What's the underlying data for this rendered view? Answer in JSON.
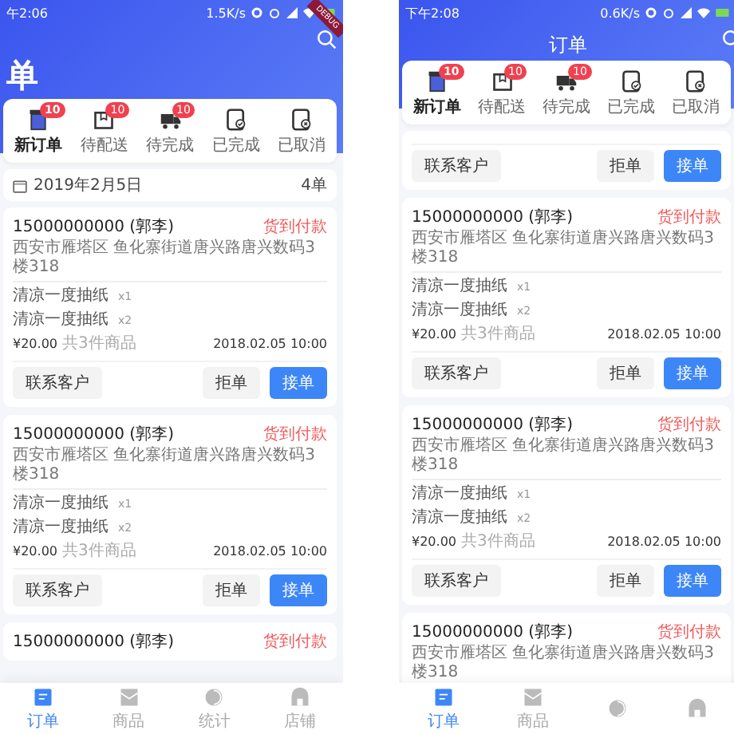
{
  "phones": [
    {
      "status_bar": {
        "time": "午2:06",
        "speed": "1.5K/s"
      },
      "debug_banner": "DEBUG",
      "title": "单",
      "title_large": true,
      "tabs": [
        {
          "label": "新订单",
          "badge": "10",
          "selected": true
        },
        {
          "label": "待配送",
          "badge": "10",
          "selected": false
        },
        {
          "label": "待完成",
          "badge": "10",
          "selected": false
        },
        {
          "label": "已完成",
          "selected": false
        },
        {
          "label": "已取消",
          "selected": false
        }
      ],
      "date_row": {
        "date": "2019年2月5日",
        "count": "4单"
      },
      "orders": [
        {
          "kind": "full",
          "phone": "15000000000 (郭李)",
          "payment": "货到付款",
          "address": "西安市雁塔区 鱼化寨街道唐兴路唐兴数码3楼318",
          "items": [
            {
              "name": "清凉一度抽纸",
              "qty": "x1"
            },
            {
              "name": "清凉一度抽纸",
              "qty": "x2"
            }
          ],
          "price": "¥20.00",
          "summary": "共3件商品",
          "time": "2018.02.05 10:00",
          "buttons": [
            {
              "label": "联系客户",
              "kind": "plain"
            },
            {
              "label": "拒单",
              "kind": "plain"
            },
            {
              "label": "接单",
              "kind": "primary"
            }
          ]
        },
        {
          "kind": "full",
          "phone": "15000000000 (郭李)",
          "payment": "货到付款",
          "address": "西安市雁塔区 鱼化寨街道唐兴路唐兴数码3楼318",
          "items": [
            {
              "name": "清凉一度抽纸",
              "qty": "x1"
            },
            {
              "name": "清凉一度抽纸",
              "qty": "x2"
            }
          ],
          "price": "¥20.00",
          "summary": "共3件商品",
          "time": "2018.02.05 10:00",
          "buttons": [
            {
              "label": "联系客户",
              "kind": "plain"
            },
            {
              "label": "拒单",
              "kind": "plain"
            },
            {
              "label": "接单",
              "kind": "primary"
            }
          ]
        },
        {
          "kind": "header",
          "phone": "15000000000 (郭李)",
          "payment": "货到付款"
        }
      ],
      "nav": [
        {
          "label": "订单",
          "selected": true
        },
        {
          "label": "商品",
          "selected": false
        },
        {
          "label": "统计",
          "selected": false
        },
        {
          "label": "店铺",
          "selected": false
        }
      ]
    },
    {
      "status_bar": {
        "time": "下午2:08",
        "speed": "0.6K/s"
      },
      "title": "订单",
      "title_large": false,
      "tabs": [
        {
          "label": "新订单",
          "badge": "10",
          "selected": true
        },
        {
          "label": "待配送",
          "badge": "10",
          "selected": false
        },
        {
          "label": "待完成",
          "badge": "10",
          "selected": false
        },
        {
          "label": "已完成",
          "selected": false
        },
        {
          "label": "已取消",
          "selected": false
        }
      ],
      "orders": [
        {
          "kind": "actions",
          "buttons": [
            {
              "label": "联系客户",
              "kind": "plain"
            },
            {
              "label": "拒单",
              "kind": "plain"
            },
            {
              "label": "接单",
              "kind": "primary"
            }
          ]
        },
        {
          "kind": "full",
          "phone": "15000000000 (郭李)",
          "payment": "货到付款",
          "address": "西安市雁塔区 鱼化寨街道唐兴路唐兴数码3楼318",
          "items": [
            {
              "name": "清凉一度抽纸",
              "qty": "x1"
            },
            {
              "name": "清凉一度抽纸",
              "qty": "x2"
            }
          ],
          "price": "¥20.00",
          "summary": "共3件商品",
          "time": "2018.02.05 10:00",
          "buttons": [
            {
              "label": "联系客户",
              "kind": "plain"
            },
            {
              "label": "拒单",
              "kind": "plain"
            },
            {
              "label": "接单",
              "kind": "primary"
            }
          ]
        },
        {
          "kind": "full",
          "phone": "15000000000 (郭李)",
          "payment": "货到付款",
          "address": "西安市雁塔区 鱼化寨街道唐兴路唐兴数码3楼318",
          "items": [
            {
              "name": "清凉一度抽纸",
              "qty": "x1"
            },
            {
              "name": "清凉一度抽纸",
              "qty": "x2"
            }
          ],
          "price": "¥20.00",
          "summary": "共3件商品",
          "time": "2018.02.05 10:00",
          "buttons": [
            {
              "label": "联系客户",
              "kind": "plain"
            },
            {
              "label": "拒单",
              "kind": "plain"
            },
            {
              "label": "接单",
              "kind": "primary"
            }
          ]
        },
        {
          "kind": "header",
          "phone": "15000000000 (郭李)",
          "payment": "货到付款",
          "address": "西安市雁塔区 鱼化寨街道唐兴路唐兴数码3楼318"
        }
      ],
      "nav": [
        {
          "label": "订单",
          "selected": true
        },
        {
          "label": "商品",
          "selected": false
        },
        {
          "selected": false
        },
        {
          "selected": false
        }
      ]
    }
  ]
}
